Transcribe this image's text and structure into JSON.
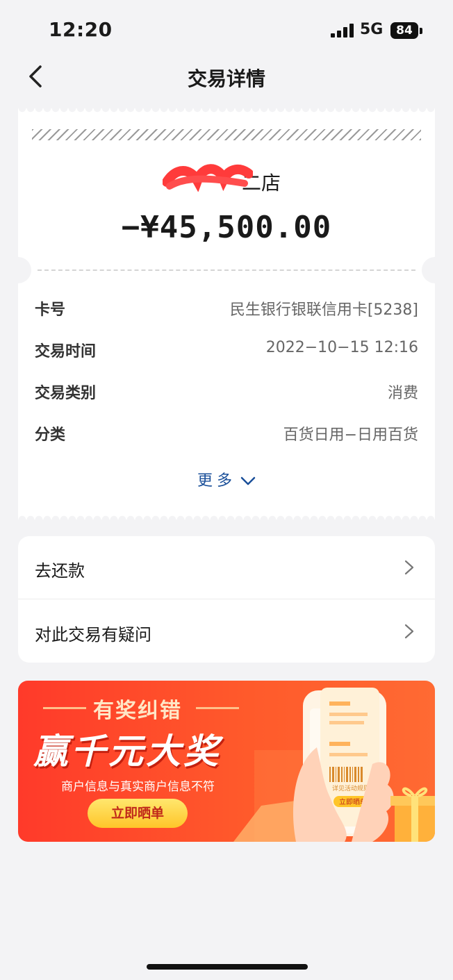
{
  "status_bar": {
    "time": "12:20",
    "network": "5G",
    "battery": "84"
  },
  "nav": {
    "title": "交易详情"
  },
  "receipt": {
    "merchant": "二店",
    "amount": "−¥45,500.00",
    "rows": [
      {
        "key": "卡号",
        "value": "民生银行银联信用卡[5238]"
      },
      {
        "key": "交易时间",
        "value": "2022−10−15 12:16"
      },
      {
        "key": "交易类别",
        "value": "消费"
      },
      {
        "key": "分类",
        "value": "百货日用−日用百货"
      }
    ],
    "more_label": "更多"
  },
  "actions": [
    {
      "label": "去还款"
    },
    {
      "label": "对此交易有疑问"
    }
  ],
  "banner": {
    "tag": "有奖纠错",
    "headline": "赢千元大奖",
    "description": "商户信息与真实商户信息不符",
    "button": "立即晒单",
    "phone_text_1": "详见活动规则",
    "phone_button": "立即晒单"
  },
  "colors": {
    "accent_blue": "#1a4f99",
    "banner_red": "#ff3a2a",
    "button_yellow": "#ffd43b"
  }
}
